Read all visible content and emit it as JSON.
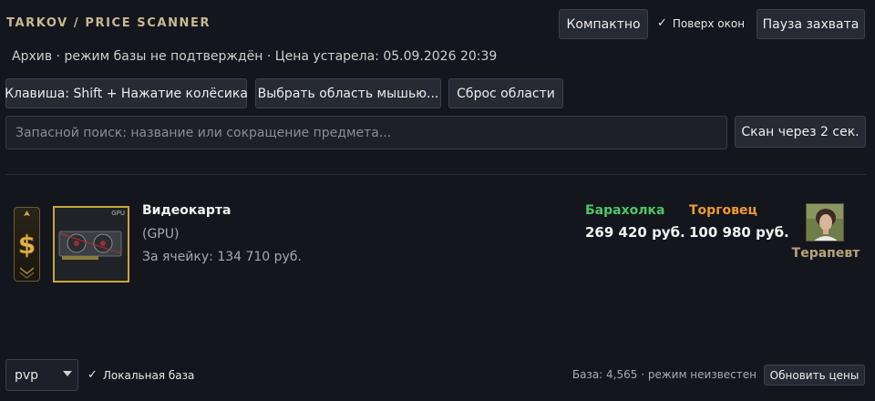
{
  "header": {
    "title": "TARKOV / PRICE SCANNER",
    "compact_label": "Компактно",
    "on_top_check": "✓",
    "on_top_label": "Поверх окон",
    "pause_label": "Пауза захвата"
  },
  "status_line": "Архив · режим базы не подтверждён · Цена устарела: 05.09.2026 20:39",
  "toolbar": {
    "hotkey_label": "Клавиша: Shift + Нажатие колёсика",
    "select_area_label": "Выбрать область мышью...",
    "reset_area_label": "Сброс области"
  },
  "search": {
    "placeholder": "Запасной поиск: название или сокращение предмета...",
    "value": "",
    "scan_button_label": "Скан через 2 сек."
  },
  "item": {
    "name": "Видеокарта",
    "short_name": "(GPU)",
    "per_cell": "За ячейку: 134 710 руб.",
    "thumb_tag": "GPU",
    "border_color": "#c8a53c",
    "rank_icon": "dollar-rank-icon"
  },
  "prices": {
    "flea_label": "Барахолка",
    "flea_price": "269 420 руб.",
    "flea_color": "#4cc768",
    "trader_label": "Торговец",
    "trader_price": "100 980 руб.",
    "trader_color": "#ef9b2f",
    "trader_name": "Терапевт"
  },
  "footer": {
    "mode_selected": "pvp",
    "local_db_check": "✓",
    "local_db_label": "Локальная база",
    "base_info": "База: 4,565 · режим неизвестен",
    "refresh_label": "Обновить цены"
  }
}
